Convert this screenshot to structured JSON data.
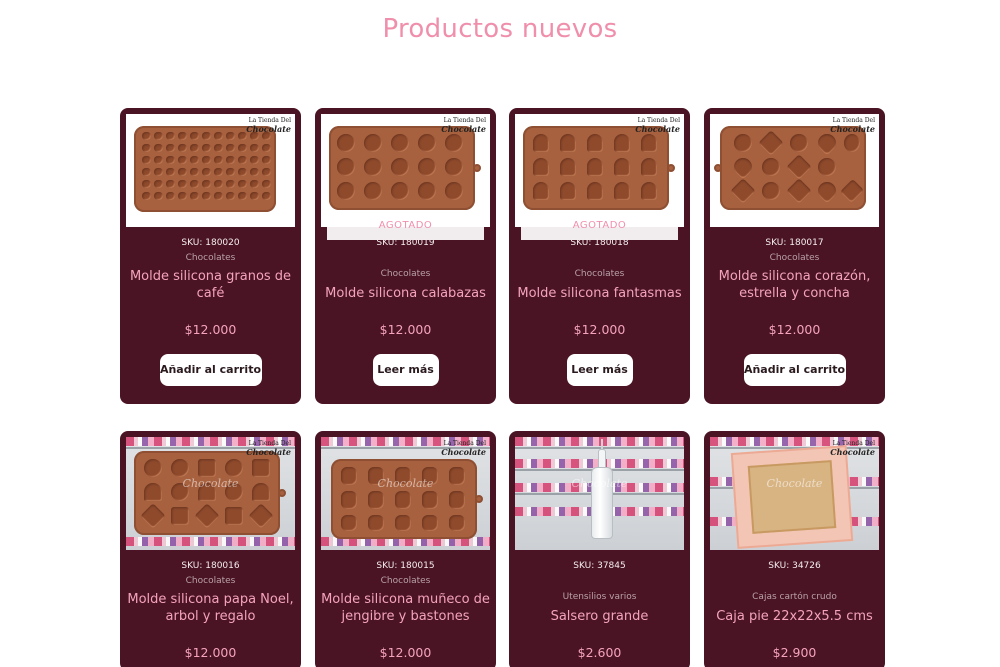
{
  "section_title": "Productos nuevos",
  "logo_text": {
    "line1": "La Tienda Del",
    "line2": "Chocolate"
  },
  "sold_out_label": "AGOTADO",
  "products": [
    {
      "sku": "SKU: 180020",
      "category": "Chocolates",
      "name": "Molde silicona granos de café",
      "price": "$12.000",
      "button": "Añadir al carrito",
      "sold_out": false
    },
    {
      "sku": "SKU: 180019",
      "category": "Chocolates",
      "name": "Molde silicona calabazas",
      "price": "$12.000",
      "button": "Leer más",
      "sold_out": true
    },
    {
      "sku": "SKU: 180018",
      "category": "Chocolates",
      "name": "Molde silicona fantasmas",
      "price": "$12.000",
      "button": "Leer más",
      "sold_out": true
    },
    {
      "sku": "SKU: 180017",
      "category": "Chocolates",
      "name": "Molde silicona corazón, estrella y concha",
      "price": "$12.000",
      "button": "Añadir al carrito",
      "sold_out": false
    },
    {
      "sku": "SKU: 180016",
      "category": "Chocolates",
      "name": "Molde silicona papa Noel, arbol y regalo",
      "price": "$12.000"
    },
    {
      "sku": "SKU: 180015",
      "category": "Chocolates",
      "name": "Molde silicona muñeco de jengibre y bastones",
      "price": "$12.000"
    },
    {
      "sku": "SKU: 37845",
      "category": "Utensilios varios",
      "name": "Salsero grande",
      "price": "$2.600"
    },
    {
      "sku": "SKU: 34726",
      "category": "Cajas cartón crudo",
      "name": "Caja pie 22x22x5.5 cms",
      "price": "$2.900"
    }
  ],
  "colors": {
    "card_bg": "#4a1424",
    "accent_pink": "#f08fac",
    "button_bg": "#ffffff"
  }
}
